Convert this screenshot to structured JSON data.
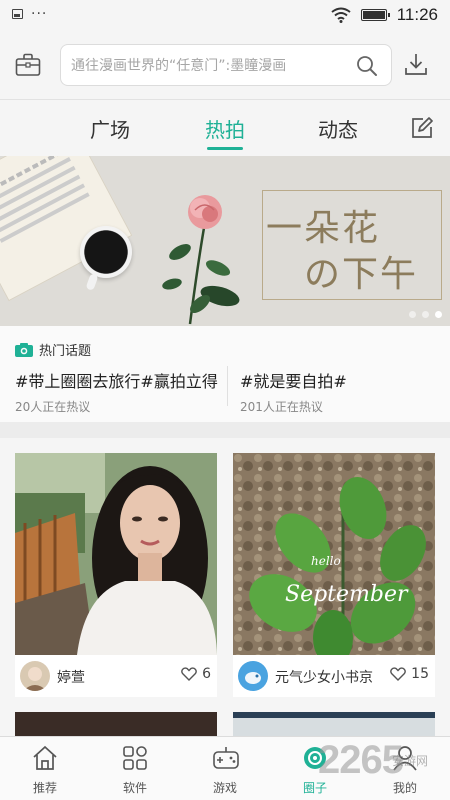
{
  "status_bar": {
    "time": "11:26",
    "dots": "···"
  },
  "search": {
    "placeholder": "通往漫画世界的“任意门”:墨瞳漫画"
  },
  "tabs": [
    {
      "label": "广场",
      "active": false
    },
    {
      "label": "热拍",
      "active": true
    },
    {
      "label": "动态",
      "active": false
    }
  ],
  "banner": {
    "title_line1": "一朵花",
    "title_line2": "の下午",
    "pages": 3,
    "active_page": 3
  },
  "hot_topics": {
    "header": "热门话题",
    "items": [
      {
        "name": "#带上圈圈去旅行#赢拍立得",
        "meta": "20人正在热议"
      },
      {
        "name": "#就是要自拍#",
        "meta": "201人正在热议"
      }
    ]
  },
  "posts": [
    {
      "user": "婷萱",
      "likes": "6"
    },
    {
      "user": "元气少女小书京",
      "likes": "15",
      "photo_text_1": "hello",
      "photo_text_2": "September"
    }
  ],
  "bottom_nav": [
    {
      "label": "推荐",
      "icon": "home-icon"
    },
    {
      "label": "软件",
      "icon": "apps-icon"
    },
    {
      "label": "游戏",
      "icon": "gamepad-icon"
    },
    {
      "label": "圈子",
      "icon": "circle-icon",
      "active": true
    },
    {
      "label": "我的",
      "icon": "user-icon"
    }
  ],
  "watermark": {
    "text": "2265",
    "sub": "安游网"
  },
  "colors": {
    "accent": "#1fb196",
    "banner_text": "#8c7c5c"
  }
}
